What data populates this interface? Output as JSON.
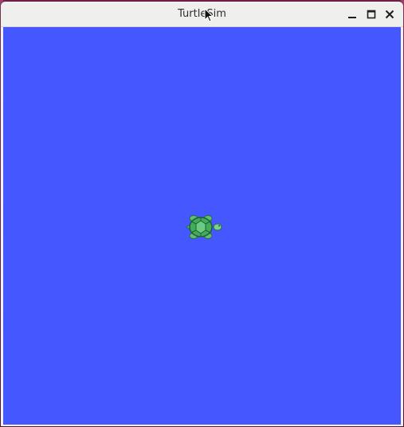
{
  "window": {
    "title": "TurtleSim",
    "controls": {
      "minimize_icon": "minimize-icon",
      "maximize_icon": "maximize-icon",
      "close_icon": "close-icon"
    }
  },
  "canvas": {
    "background_color": "#4558ff"
  },
  "turtle": {
    "icon": "turtle-icon",
    "shell_color": "#3fae5b",
    "body_color": "#7ad08c"
  }
}
